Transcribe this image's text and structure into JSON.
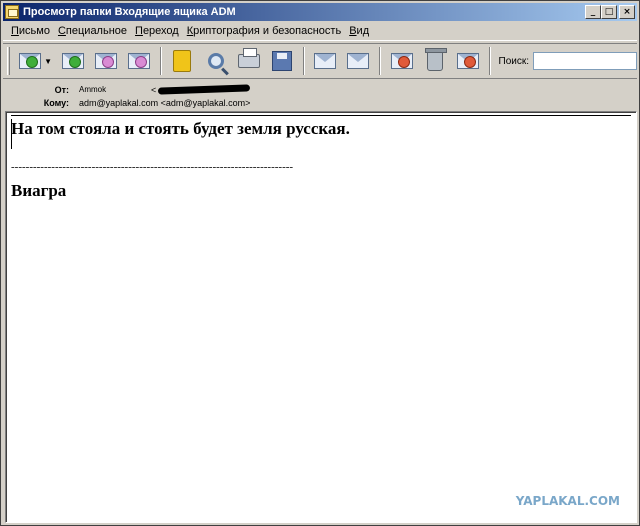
{
  "window": {
    "title": "Просмотр папки Входящие ящика ADM",
    "minimize": "_",
    "maximize": "□",
    "close": "×"
  },
  "menu": {
    "items": [
      "Письмо",
      "Специальное",
      "Переход",
      "Криптография и безопасность",
      "Вид"
    ]
  },
  "toolbar": {
    "search_label": "Поиск:",
    "search_value": ""
  },
  "headers": {
    "from_label": "От:",
    "from_name": "Ammok",
    "from_email_open": "<",
    "to_label": "Кому:",
    "to_value": "adm@yaplakal.com <adm@yaplakal.com>"
  },
  "message": {
    "line1": "На том стояла и стоять будет земля русская.",
    "dashes": "-----------------------------------------------------------------------------",
    "line2": "Виагра"
  },
  "watermark": "YAPLAKAL.COM"
}
